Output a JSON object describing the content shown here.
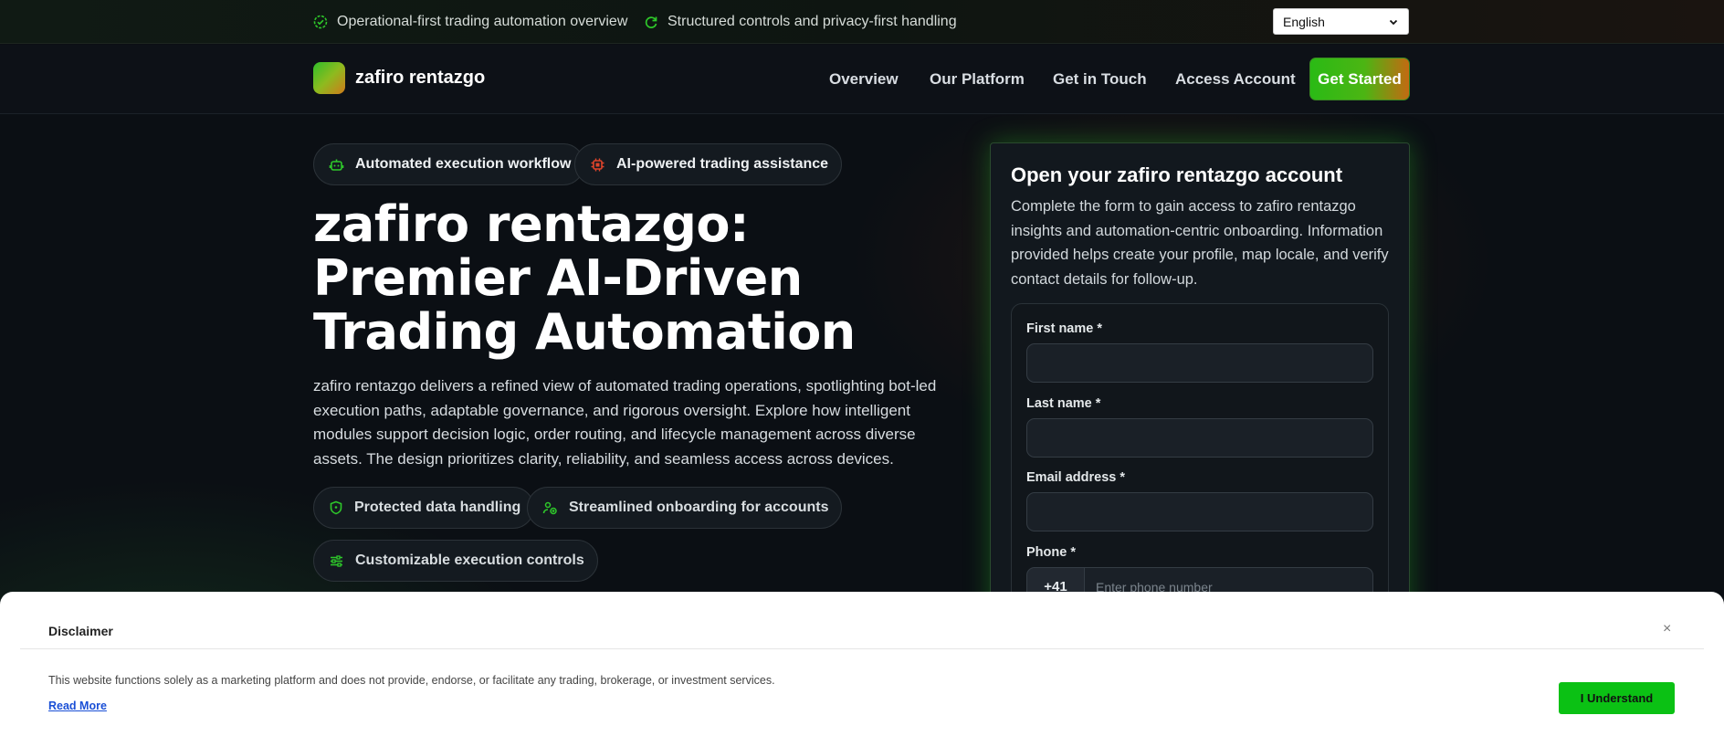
{
  "topbar": {
    "items": [
      {
        "label": "Operational-first trading automation overview",
        "icon": "badge-check-icon"
      },
      {
        "label": "Structured controls and privacy-first handling",
        "icon": "refresh-icon"
      }
    ],
    "language": "English"
  },
  "nav": {
    "brand": "zafiro rentazgo",
    "links": [
      "Overview",
      "Our Platform",
      "Get in Touch",
      "Access Account"
    ],
    "cta": "Get Started"
  },
  "hero": {
    "tags": [
      {
        "label": "Automated execution workflow",
        "icon": "robot-icon"
      },
      {
        "label": "AI-powered trading assistance",
        "icon": "cpu-icon"
      }
    ],
    "title": "zafiro rentazgo: Premier AI-Driven Trading Automation",
    "description": "zafiro rentazgo delivers a refined view of automated trading operations, spotlighting bot-led execution paths, adaptable governance, and rigorous oversight. Explore how intelligent modules support decision logic, order routing, and lifecycle management across diverse assets. The design prioritizes clarity, reliability, and seamless access across devices.",
    "features": [
      {
        "label": "Protected data handling",
        "icon": "shield-icon"
      },
      {
        "label": "Streamlined onboarding for accounts",
        "icon": "users-icon"
      },
      {
        "label": "Customizable execution controls",
        "icon": "sliders-icon"
      }
    ]
  },
  "form": {
    "title": "Open your zafiro rentazgo account",
    "description": "Complete the form to gain access to zafiro rentazgo insights and automation-centric onboarding. Information provided helps create your profile, map locale, and verify contact details for follow-up.",
    "first_name_label": "First name *",
    "last_name_label": "Last name *",
    "email_label": "Email address *",
    "phone_label": "Phone *",
    "phone_prefix": "+41",
    "phone_placeholder": "Enter phone number"
  },
  "disclaimer": {
    "title": "Disclaimer",
    "close": "×",
    "text": "This website functions solely as a marketing platform and does not provide, endorse, or facilitate any trading, brokerage, or investment services.",
    "read_more": "Read More",
    "button": "I Understand"
  },
  "colors": {
    "accent_green": "#2aba15",
    "accent_orange": "#c36a12",
    "icon_red": "#e0442a",
    "background": "#0b0f14"
  }
}
